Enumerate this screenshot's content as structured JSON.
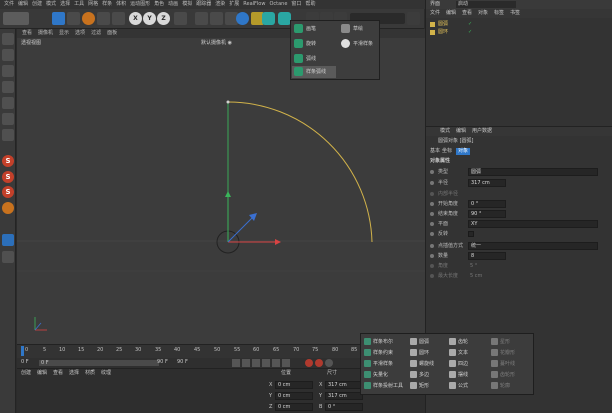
{
  "menu": [
    "文件",
    "编辑",
    "创建",
    "模式",
    "选择",
    "工具",
    "网格",
    "样条",
    "体积",
    "运动图形",
    "角色",
    "动画",
    "模拟",
    "跟踪器",
    "渲染",
    "扩展",
    "RealFlow",
    "Octane",
    "窗口",
    "帮助"
  ],
  "layout": {
    "label": "界面",
    "value": "启动"
  },
  "toolbar": {
    "x_label": "X",
    "y_label": "Y",
    "z_label": "Z"
  },
  "viewport": {
    "menu": [
      "查看",
      "摄像机",
      "显示",
      "选项",
      "过滤",
      "面板"
    ],
    "title": "透视视图",
    "camera": "默认摄像机 ◉"
  },
  "spline_popup": {
    "items": [
      "画笔",
      "草绘",
      "旋转",
      "平滑样条",
      "弧线",
      "样条弧线"
    ]
  },
  "object_manager": {
    "tabs": [
      "文件",
      "编辑",
      "查看",
      "对象",
      "标签",
      "书签"
    ],
    "items": [
      {
        "name": "圆弧",
        "checked": true
      },
      {
        "name": "圆环",
        "checked": true
      }
    ]
  },
  "attribute_manager": {
    "tabs": [
      "模式",
      "编辑",
      "用户数据"
    ],
    "object_title": "圆弧对象 [圆弧]",
    "subtabs": [
      "基本",
      "坐标",
      "对象"
    ],
    "section": "对象属性",
    "rows": [
      {
        "label": "类型",
        "value": "圆弧"
      },
      {
        "label": "半径",
        "value": "317 cm"
      },
      {
        "label": "内部半径",
        "value": ""
      },
      {
        "label": "开始角度",
        "value": "0 °"
      },
      {
        "label": "结束角度",
        "value": "90 °"
      },
      {
        "label": "平面",
        "value": "XY"
      },
      {
        "label": "反转",
        "value": ""
      },
      {
        "label": "点插值方式",
        "value": "统一"
      },
      {
        "label": "数量",
        "value": "8"
      },
      {
        "label": "角度",
        "value": "5 °"
      },
      {
        "label": "最大长度",
        "value": "5 cm"
      }
    ]
  },
  "timeline": {
    "ticks": [
      "0",
      "5",
      "10",
      "15",
      "20",
      "25",
      "30",
      "35",
      "40",
      "45",
      "50",
      "55",
      "60",
      "65",
      "70",
      "75",
      "80",
      "85"
    ],
    "start": "0 F",
    "current": "0 F",
    "end": "90 F",
    "end2": "90 F"
  },
  "bottom": {
    "menu": [
      "创建",
      "编辑",
      "查看",
      "选择",
      "材质",
      "纹理"
    ],
    "coords_header": "位置",
    "size_header": "尺寸",
    "rows": [
      {
        "axis": "X",
        "pos": "0 cm",
        "size_axis": "X",
        "size": "317 cm"
      },
      {
        "axis": "Y",
        "pos": "0 cm",
        "size_axis": "Y",
        "size": "317 cm"
      },
      {
        "axis": "Z",
        "pos": "0 cm",
        "size_axis": "B",
        "size": "0 °"
      }
    ]
  },
  "arrange_popup": {
    "col1": [
      "样条布尔",
      "样条约束",
      "平滑样条",
      "矢量化",
      "样条投射工具"
    ],
    "col2": [
      "圆弧",
      "圆环",
      "螺旋线",
      "多边",
      "矩形"
    ],
    "col3": [
      "齿轮",
      "文本",
      "四边",
      "摆线",
      "公式"
    ],
    "col4": [
      "星形",
      "花瓣形",
      "蔓叶线",
      "齿轮形",
      "轮廓"
    ]
  },
  "colors": {
    "arc": "#d2b34a",
    "accent": "#2f77c8",
    "y_axis": "#3ab55a",
    "x_axis": "#d94343"
  }
}
